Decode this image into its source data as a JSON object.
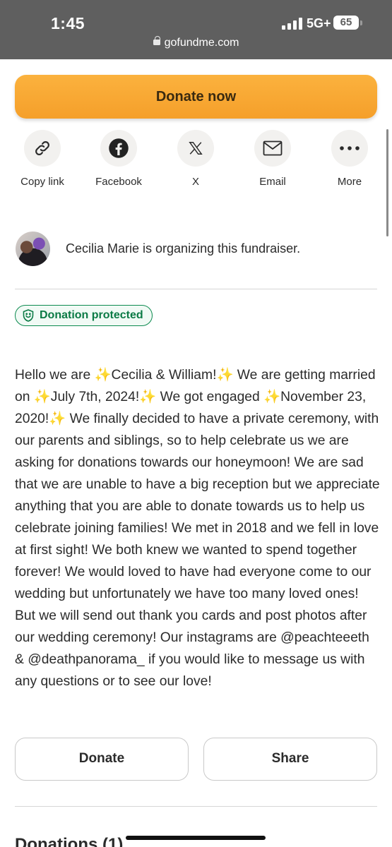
{
  "status_bar": {
    "time": "1:45",
    "network": "5G+",
    "battery": "65"
  },
  "browser": {
    "url": "gofundme.com"
  },
  "donate_now_label": "Donate now",
  "share_options": [
    {
      "label": "Copy link",
      "icon": "link-icon"
    },
    {
      "label": "Facebook",
      "icon": "facebook-icon"
    },
    {
      "label": "X",
      "icon": "x-logo-icon"
    },
    {
      "label": "Email",
      "icon": "email-icon"
    },
    {
      "label": "More",
      "icon": "more-icon"
    }
  ],
  "organizer": {
    "text": "Cecilia Marie is organizing this fundraiser."
  },
  "badge": {
    "label": "Donation protected"
  },
  "story": "Hello we are ✨Cecilia & William!✨ We are getting married on ✨July 7th, 2024!✨ We got engaged ✨November 23, 2020!✨ We finally decided to have a private ceremony, with our parents and siblings, so to help celebrate us we are asking for donations towards our honeymoon! We are sad that we are unable to have a big reception but we appreciate anything that you are able to donate towards us to help us celebrate joining families! We met in 2018 and we fell in love at first sight! We both knew we wanted to spend together forever! We would loved to have had everyone come to our wedding but unfortunately we have too many loved ones! But we will send out thank you cards and post photos after our wedding ceremony! Our instagrams are @peachteeeth & @deathpanorama_ if you would like to message us with any questions or to see our love!",
  "actions": {
    "donate_label": "Donate",
    "share_label": "Share"
  },
  "donations_heading": "Donations (1)",
  "colors": {
    "accent_orange": "#f7a72f",
    "protected_green": "#0b7a45"
  }
}
